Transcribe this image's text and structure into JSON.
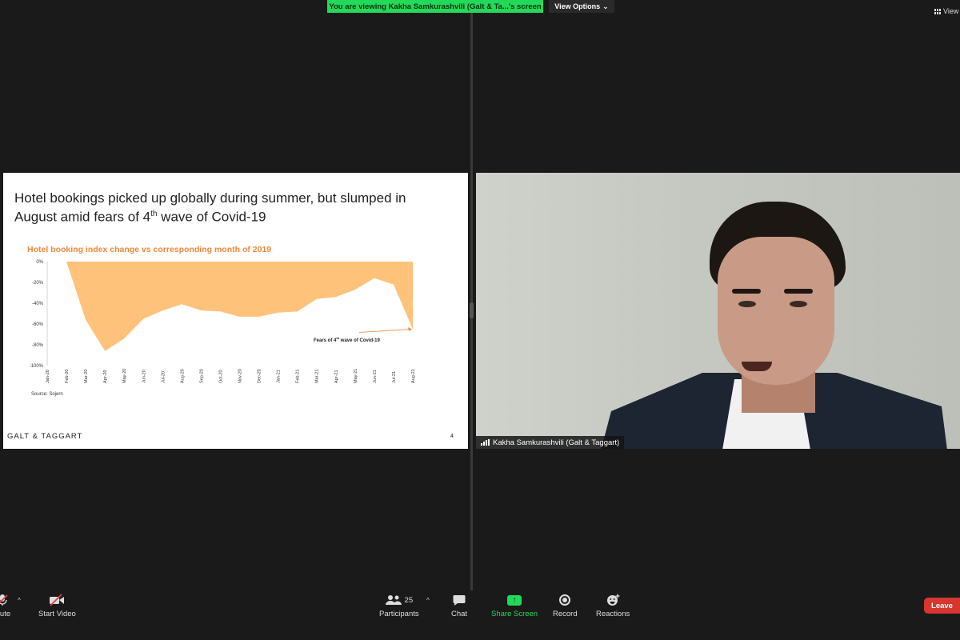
{
  "banner": {
    "text": "You are viewing Kakha Samkurashvili (Galt & Ta...'s screen"
  },
  "view_options": {
    "label": "View Options",
    "icon": "chevron-down-icon"
  },
  "view_top": {
    "label": "View",
    "icon": "grid-icon"
  },
  "slide": {
    "title_line1": "Hotel bookings picked up globally during summer, but slumped in",
    "title_line2_pre": "August amid fears of 4",
    "title_sup": "th",
    "title_line2_post": " wave of Covid-19",
    "annotation_pre": "Fears of 4",
    "annotation_sup": "th",
    "annotation_post": " wave of Covid-19",
    "source": "Source: Sojern",
    "brand": "GALT & TAGGART",
    "page_number": "4"
  },
  "chart_data": {
    "type": "area",
    "title": "Hotel booking index change vs corresponding month of 2019",
    "categories": [
      "Jan-20",
      "Feb-20",
      "Mar-20",
      "Apr-20",
      "May-20",
      "Jun-20",
      "Jul-20",
      "Aug-20",
      "Sep-20",
      "Oct-20",
      "Nov-20",
      "Dec-20",
      "Jan-21",
      "Feb-21",
      "Mar-21",
      "Apr-21",
      "May-21",
      "Jun-21",
      "Jul-21",
      "Aug-21"
    ],
    "values": [
      0,
      0,
      -56,
      -86,
      -74,
      -55,
      -47,
      -41,
      -47,
      -48,
      -53,
      -53,
      -49,
      -48,
      -36,
      -34,
      -27,
      -16,
      -22,
      -65
    ],
    "ylim": [
      -100,
      0
    ],
    "yticks": [
      "0%",
      "-20%",
      "-40%",
      "-60%",
      "-80%",
      "-100%"
    ],
    "fill_color": "#ffc27a",
    "title_color": "#f0893a"
  },
  "presenter": {
    "name": "Kakha Samkurashvili (Galt & Taggart)"
  },
  "toolbar": {
    "mute": "mute",
    "start_video": "Start Video",
    "participants": "Participants",
    "participants_count": "25",
    "chat": "Chat",
    "share_screen": "Share Screen",
    "record": "Record",
    "reactions": "Reactions",
    "leave": "Leave"
  }
}
